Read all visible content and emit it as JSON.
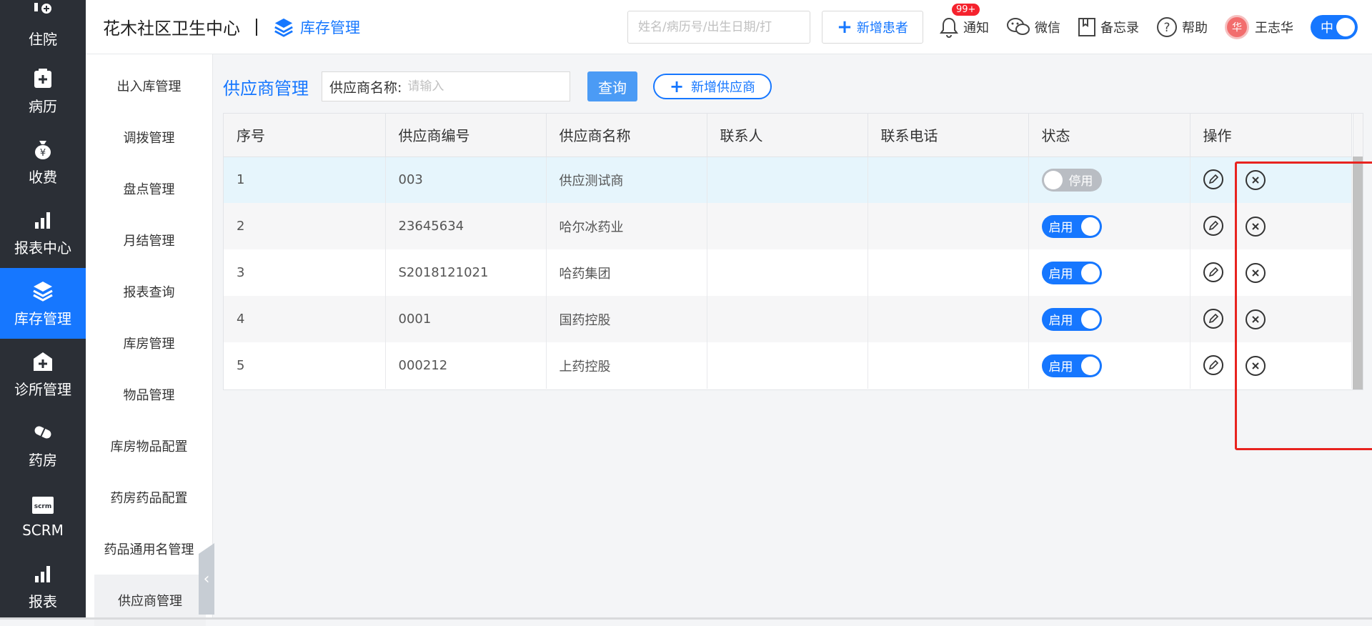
{
  "leftnav": {
    "items": [
      {
        "label": "住院",
        "icon": "inpatient-icon"
      },
      {
        "label": "病历",
        "icon": "medical-record-icon"
      },
      {
        "label": "收费",
        "icon": "money-bag-icon"
      },
      {
        "label": "报表中心",
        "icon": "bar-chart-icon"
      },
      {
        "label": "库存管理",
        "icon": "layers-icon",
        "active": true
      },
      {
        "label": "诊所管理",
        "icon": "clinic-icon"
      },
      {
        "label": "药房",
        "icon": "pill-icon"
      },
      {
        "label": "SCRM",
        "icon": "scrm-icon"
      },
      {
        "label": "报表",
        "icon": "bar-chart-icon"
      }
    ]
  },
  "header": {
    "clinic_name": "花木社区卫生中心",
    "module": "库存管理",
    "search_placeholder": "姓名/病历号/出生日期/打",
    "new_patient_label": "新增患者",
    "notify_label": "通知",
    "notify_badge": "99+",
    "wechat_label": "微信",
    "memo_label": "备忘录",
    "help_label": "帮助",
    "avatar_text": "华",
    "user_name": "王志华",
    "lang_label": "中"
  },
  "subnav": {
    "items": [
      "出入库管理",
      "调拨管理",
      "盘点管理",
      "月结管理",
      "报表查询",
      "库房管理",
      "物品管理",
      "库房物品配置",
      "药房药品配置",
      "药品通用名管理",
      "供应商管理"
    ]
  },
  "main": {
    "title": "供应商管理",
    "filter_label": "供应商名称:",
    "filter_placeholder": "请输入",
    "query_label": "查询",
    "add_supplier_label": "新增供应商",
    "columns": [
      "序号",
      "供应商编号",
      "供应商名称",
      "联系人",
      "联系电话",
      "状态",
      "操作"
    ],
    "rows": [
      {
        "no": "1",
        "code": "003",
        "name": "供应测试商",
        "contact": "",
        "phone": "",
        "status": "停用",
        "enabled": false
      },
      {
        "no": "2",
        "code": "23645634",
        "name": "哈尔冰药业",
        "contact": "",
        "phone": "",
        "status": "启用",
        "enabled": true
      },
      {
        "no": "3",
        "code": "S2018121021",
        "name": "哈药集团",
        "contact": "",
        "phone": "",
        "status": "启用",
        "enabled": true
      },
      {
        "no": "4",
        "code": "0001",
        "name": "国药控股",
        "contact": "",
        "phone": "",
        "status": "启用",
        "enabled": true
      },
      {
        "no": "5",
        "code": "000212",
        "name": "上药控股",
        "contact": "",
        "phone": "",
        "status": "启用",
        "enabled": true
      }
    ]
  },
  "colors": {
    "primary": "#1677ff",
    "nav_bg": "#2b2f36",
    "highlight": "#e8231f",
    "switch_off": "#b9bdc3"
  }
}
